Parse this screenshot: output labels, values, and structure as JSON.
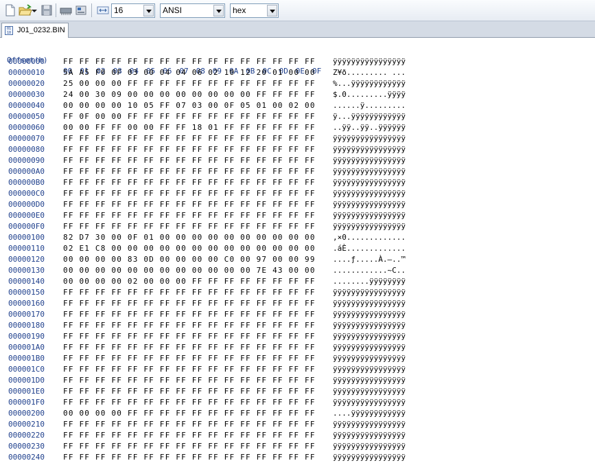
{
  "toolbar": {
    "bytes_per_row": "16",
    "charset": "ANSI",
    "display_mode": "hex"
  },
  "tabs": [
    {
      "label": "J01_0232.BIN"
    }
  ],
  "hex": {
    "offset_header": "Offset(h)",
    "column_headers": [
      "00",
      "01",
      "02",
      "03",
      "04",
      "05",
      "06",
      "07",
      "08",
      "09",
      "0A",
      "0B",
      "0C",
      "0D",
      "0E",
      "0F"
    ],
    "rows": [
      {
        "offset": "00000000",
        "bytes": "FF FF FF FF FF FF FF FF FF FF FF FF FF FF FF FF",
        "ascii": "ÿÿÿÿÿÿÿÿÿÿÿÿÿÿÿÿ"
      },
      {
        "offset": "00000010",
        "bytes": "5A A5 F0 0F 03 00 04 04 06 02 10 12 20 01 00 00",
        "ascii": "Z¥ð......... ..."
      },
      {
        "offset": "00000020",
        "bytes": "25 00 00 00 FF FF FF FF FF FF FF FF FF FF FF FF",
        "ascii": "%...ÿÿÿÿÿÿÿÿÿÿÿÿ"
      },
      {
        "offset": "00000030",
        "bytes": "24 00 30 09 00 00 00 00 00 00 00 00 FF FF FF FF",
        "ascii": "$.0.........ÿÿÿÿ"
      },
      {
        "offset": "00000040",
        "bytes": "00 00 00 00 10 05 FF 07 03 00 0F 05 01 00 02 00",
        "ascii": "......ÿ........."
      },
      {
        "offset": "00000050",
        "bytes": "FF 0F 00 00 FF FF FF FF FF FF FF FF FF FF FF FF",
        "ascii": "ÿ...ÿÿÿÿÿÿÿÿÿÿÿÿ"
      },
      {
        "offset": "00000060",
        "bytes": "00 00 FF FF 00 00 FF FF 18 01 FF FF FF FF FF FF",
        "ascii": "..ÿÿ..ÿÿ..ÿÿÿÿÿÿ"
      },
      {
        "offset": "00000070",
        "bytes": "FF FF FF FF FF FF FF FF FF FF FF FF FF FF FF FF",
        "ascii": "ÿÿÿÿÿÿÿÿÿÿÿÿÿÿÿÿ"
      },
      {
        "offset": "00000080",
        "bytes": "FF FF FF FF FF FF FF FF FF FF FF FF FF FF FF FF",
        "ascii": "ÿÿÿÿÿÿÿÿÿÿÿÿÿÿÿÿ"
      },
      {
        "offset": "00000090",
        "bytes": "FF FF FF FF FF FF FF FF FF FF FF FF FF FF FF FF",
        "ascii": "ÿÿÿÿÿÿÿÿÿÿÿÿÿÿÿÿ"
      },
      {
        "offset": "000000A0",
        "bytes": "FF FF FF FF FF FF FF FF FF FF FF FF FF FF FF FF",
        "ascii": "ÿÿÿÿÿÿÿÿÿÿÿÿÿÿÿÿ"
      },
      {
        "offset": "000000B0",
        "bytes": "FF FF FF FF FF FF FF FF FF FF FF FF FF FF FF FF",
        "ascii": "ÿÿÿÿÿÿÿÿÿÿÿÿÿÿÿÿ"
      },
      {
        "offset": "000000C0",
        "bytes": "FF FF FF FF FF FF FF FF FF FF FF FF FF FF FF FF",
        "ascii": "ÿÿÿÿÿÿÿÿÿÿÿÿÿÿÿÿ"
      },
      {
        "offset": "000000D0",
        "bytes": "FF FF FF FF FF FF FF FF FF FF FF FF FF FF FF FF",
        "ascii": "ÿÿÿÿÿÿÿÿÿÿÿÿÿÿÿÿ"
      },
      {
        "offset": "000000E0",
        "bytes": "FF FF FF FF FF FF FF FF FF FF FF FF FF FF FF FF",
        "ascii": "ÿÿÿÿÿÿÿÿÿÿÿÿÿÿÿÿ"
      },
      {
        "offset": "000000F0",
        "bytes": "FF FF FF FF FF FF FF FF FF FF FF FF FF FF FF FF",
        "ascii": "ÿÿÿÿÿÿÿÿÿÿÿÿÿÿÿÿ"
      },
      {
        "offset": "00000100",
        "bytes": "82 D7 30 00 0F 01 00 00 00 00 00 00 00 00 00 00",
        "ascii": "‚×0............."
      },
      {
        "offset": "00000110",
        "bytes": "02 E1 C8 00 00 00 00 00 00 00 00 00 00 00 00 00",
        "ascii": ".áÈ............."
      },
      {
        "offset": "00000120",
        "bytes": "00 00 00 00 83 0D 00 00 00 00 C0 00 97 00 00 99",
        "ascii": "....ƒ.....À.—..™"
      },
      {
        "offset": "00000130",
        "bytes": "00 00 00 00 00 00 00 00 00 00 00 00 7E 43 00 00",
        "ascii": "............~C.."
      },
      {
        "offset": "00000140",
        "bytes": "00 00 00 00 02 00 00 00 FF FF FF FF FF FF FF FF",
        "ascii": "........ÿÿÿÿÿÿÿÿ"
      },
      {
        "offset": "00000150",
        "bytes": "FF FF FF FF FF FF FF FF FF FF FF FF FF FF FF FF",
        "ascii": "ÿÿÿÿÿÿÿÿÿÿÿÿÿÿÿÿ"
      },
      {
        "offset": "00000160",
        "bytes": "FF FF FF FF FF FF FF FF FF FF FF FF FF FF FF FF",
        "ascii": "ÿÿÿÿÿÿÿÿÿÿÿÿÿÿÿÿ"
      },
      {
        "offset": "00000170",
        "bytes": "FF FF FF FF FF FF FF FF FF FF FF FF FF FF FF FF",
        "ascii": "ÿÿÿÿÿÿÿÿÿÿÿÿÿÿÿÿ"
      },
      {
        "offset": "00000180",
        "bytes": "FF FF FF FF FF FF FF FF FF FF FF FF FF FF FF FF",
        "ascii": "ÿÿÿÿÿÿÿÿÿÿÿÿÿÿÿÿ"
      },
      {
        "offset": "00000190",
        "bytes": "FF FF FF FF FF FF FF FF FF FF FF FF FF FF FF FF",
        "ascii": "ÿÿÿÿÿÿÿÿÿÿÿÿÿÿÿÿ"
      },
      {
        "offset": "000001A0",
        "bytes": "FF FF FF FF FF FF FF FF FF FF FF FF FF FF FF FF",
        "ascii": "ÿÿÿÿÿÿÿÿÿÿÿÿÿÿÿÿ"
      },
      {
        "offset": "000001B0",
        "bytes": "FF FF FF FF FF FF FF FF FF FF FF FF FF FF FF FF",
        "ascii": "ÿÿÿÿÿÿÿÿÿÿÿÿÿÿÿÿ"
      },
      {
        "offset": "000001C0",
        "bytes": "FF FF FF FF FF FF FF FF FF FF FF FF FF FF FF FF",
        "ascii": "ÿÿÿÿÿÿÿÿÿÿÿÿÿÿÿÿ"
      },
      {
        "offset": "000001D0",
        "bytes": "FF FF FF FF FF FF FF FF FF FF FF FF FF FF FF FF",
        "ascii": "ÿÿÿÿÿÿÿÿÿÿÿÿÿÿÿÿ"
      },
      {
        "offset": "000001E0",
        "bytes": "FF FF FF FF FF FF FF FF FF FF FF FF FF FF FF FF",
        "ascii": "ÿÿÿÿÿÿÿÿÿÿÿÿÿÿÿÿ"
      },
      {
        "offset": "000001F0",
        "bytes": "FF FF FF FF FF FF FF FF FF FF FF FF FF FF FF FF",
        "ascii": "ÿÿÿÿÿÿÿÿÿÿÿÿÿÿÿÿ"
      },
      {
        "offset": "00000200",
        "bytes": "00 00 00 00 FF FF FF FF FF FF FF FF FF FF FF FF",
        "ascii": "....ÿÿÿÿÿÿÿÿÿÿÿÿ"
      },
      {
        "offset": "00000210",
        "bytes": "FF FF FF FF FF FF FF FF FF FF FF FF FF FF FF FF",
        "ascii": "ÿÿÿÿÿÿÿÿÿÿÿÿÿÿÿÿ"
      },
      {
        "offset": "00000220",
        "bytes": "FF FF FF FF FF FF FF FF FF FF FF FF FF FF FF FF",
        "ascii": "ÿÿÿÿÿÿÿÿÿÿÿÿÿÿÿÿ"
      },
      {
        "offset": "00000230",
        "bytes": "FF FF FF FF FF FF FF FF FF FF FF FF FF FF FF FF",
        "ascii": "ÿÿÿÿÿÿÿÿÿÿÿÿÿÿÿÿ"
      },
      {
        "offset": "00000240",
        "bytes": "FF FF FF FF FF FF FF FF FF FF FF FF FF FF FF FF",
        "ascii": "ÿÿÿÿÿÿÿÿÿÿÿÿÿÿÿÿ"
      }
    ]
  }
}
